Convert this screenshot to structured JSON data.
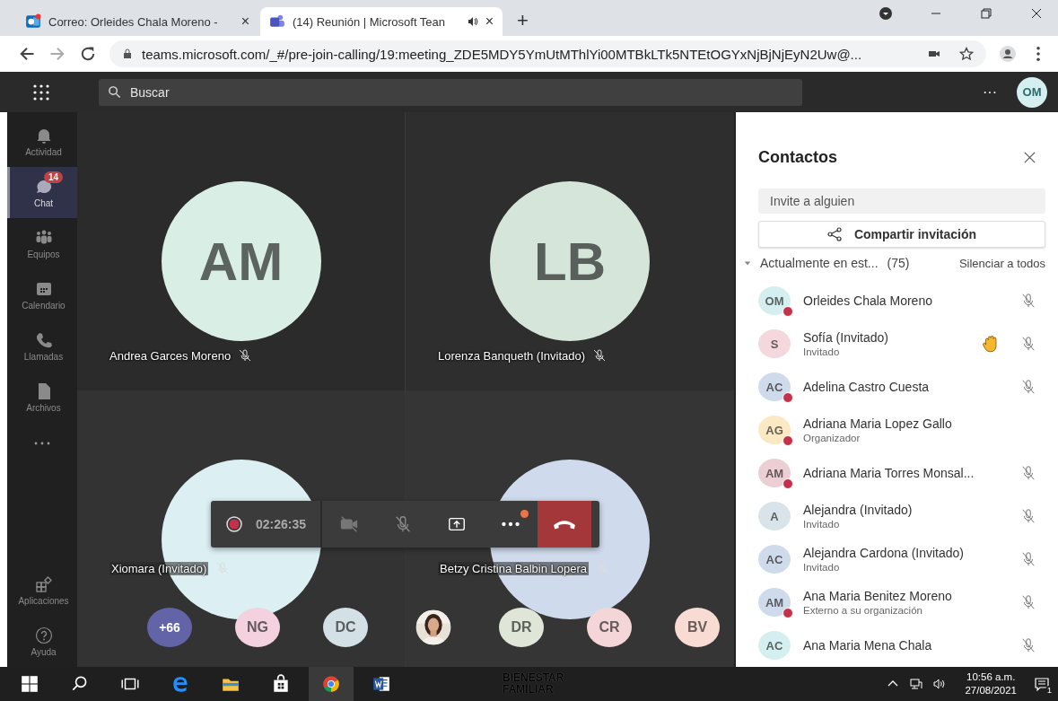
{
  "browser": {
    "tabs": [
      {
        "title": "Correo: Orleides Chala Moreno -",
        "selected": false,
        "audio": false,
        "close": "×"
      },
      {
        "title": "(14) Reunión | Microsoft Tean",
        "selected": true,
        "audio": true,
        "close": "×"
      }
    ],
    "new_tab": "+",
    "url": "teams.microsoft.com/_#/pre-join-calling/19:meeting_ZDE5MDY5YmUtMThlYi00MTBkLTk5NTEtOGYxNjBjNjEyN2Uw@..."
  },
  "header": {
    "search_placeholder": "Buscar",
    "more": "···",
    "avatar": "OM"
  },
  "sidebar": {
    "items": [
      {
        "label": "Actividad",
        "selected": false
      },
      {
        "label": "Chat",
        "selected": true,
        "badge": "14"
      },
      {
        "label": "Equipos",
        "selected": false
      },
      {
        "label": "Calendario",
        "selected": false
      },
      {
        "label": "Llamadas",
        "selected": false
      },
      {
        "label": "Archivos",
        "selected": false
      }
    ],
    "bottom_items": [
      {
        "label": "Aplicaciones",
        "selected": false
      },
      {
        "label": "Ayuda",
        "selected": false
      }
    ]
  },
  "tiles": [
    {
      "initials": "AM",
      "name": "Andrea Garces Moreno",
      "color": "#d9efe5",
      "muted": true
    },
    {
      "initials": "LB",
      "name": "Lorenza Banqueth (Invitado)",
      "color": "#d5e5da",
      "muted": true
    },
    {
      "name": "Xiomara (Invitado)",
      "color": "#dcf0f3",
      "muted": true
    },
    {
      "name": "Betzy Cristina Balbin Lopera",
      "color": "#cfdbec",
      "muted": true
    }
  ],
  "call_bar": {
    "recording": true,
    "time": "02:26:35",
    "camera_on": false,
    "mic_on": false,
    "more_badge": true
  },
  "gallery": [
    {
      "kind": "overflow",
      "label": "+66",
      "color": "#6264a7"
    },
    {
      "kind": "initials",
      "label": "NG",
      "color": "#f3d1de"
    },
    {
      "kind": "initials",
      "label": "DC",
      "color": "#d3e0e6"
    },
    {
      "kind": "picture"
    },
    {
      "kind": "initials",
      "label": "DR",
      "color": "#dfe6d8"
    },
    {
      "kind": "initials",
      "label": "CR",
      "color": "#f5d6d8"
    },
    {
      "kind": "initials",
      "label": "BV",
      "color": "#f8dcd3"
    }
  ],
  "panel": {
    "title": "Contactos",
    "invite_placeholder": "Invite a alguien",
    "share_button": "Compartir invitación",
    "section": {
      "title": "Actualmente en est...",
      "count": "(75)",
      "expanded": true,
      "action": "Silenciar a todos"
    },
    "participants": [
      {
        "initials": "OM",
        "name": "Orleides Chala Moreno",
        "color": "#d5eff0",
        "busy": true,
        "muted": true,
        "hand_raised": false
      },
      {
        "initials": "S",
        "name": "Sofía (Invitado)",
        "role": "Invitado",
        "color": "#f4d8dd",
        "busy": false,
        "muted": true,
        "hand_raised": true
      },
      {
        "initials": "AC",
        "name": "Adelina Castro Cuesta",
        "color": "#cfdbeb",
        "busy": true,
        "muted": true,
        "hand_raised": false
      },
      {
        "initials": "AG",
        "name": "Adriana Maria Lopez Gallo",
        "role": "Organizador",
        "color": "#fbe9c3",
        "busy": true,
        "muted": false,
        "hand_raised": false
      },
      {
        "initials": "AM",
        "name": "Adriana Maria Torres Monsal...",
        "color": "#eccfd4",
        "busy": true,
        "muted": true,
        "hand_raised": false
      },
      {
        "initials": "A",
        "name": "Alejandra (Invitado)",
        "role": "Invitado",
        "color": "#d8e4ea",
        "busy": false,
        "muted": true,
        "hand_raised": false
      },
      {
        "initials": "AC",
        "name": "Alejandra Cardona (Invitado)",
        "role": "Invitado",
        "color": "#cfdbeb",
        "busy": false,
        "muted": true,
        "hand_raised": false
      },
      {
        "initials": "AM",
        "name": "Ana Maria Benitez Moreno",
        "role": "Externo a su organización",
        "color": "#cfdbeb",
        "busy": true,
        "muted": true,
        "hand_raised": false
      },
      {
        "initials": "AC",
        "name": "Ana Maria Mena Chala",
        "color": "#d5eff0",
        "busy": false,
        "muted": true,
        "hand_raised": false
      }
    ]
  },
  "taskbar": {
    "overlay_text": [
      "BIENESTAR",
      "FAMILIAR"
    ],
    "time": "10:56 a.m.",
    "date": "27/08/2021",
    "notifications": "1"
  }
}
